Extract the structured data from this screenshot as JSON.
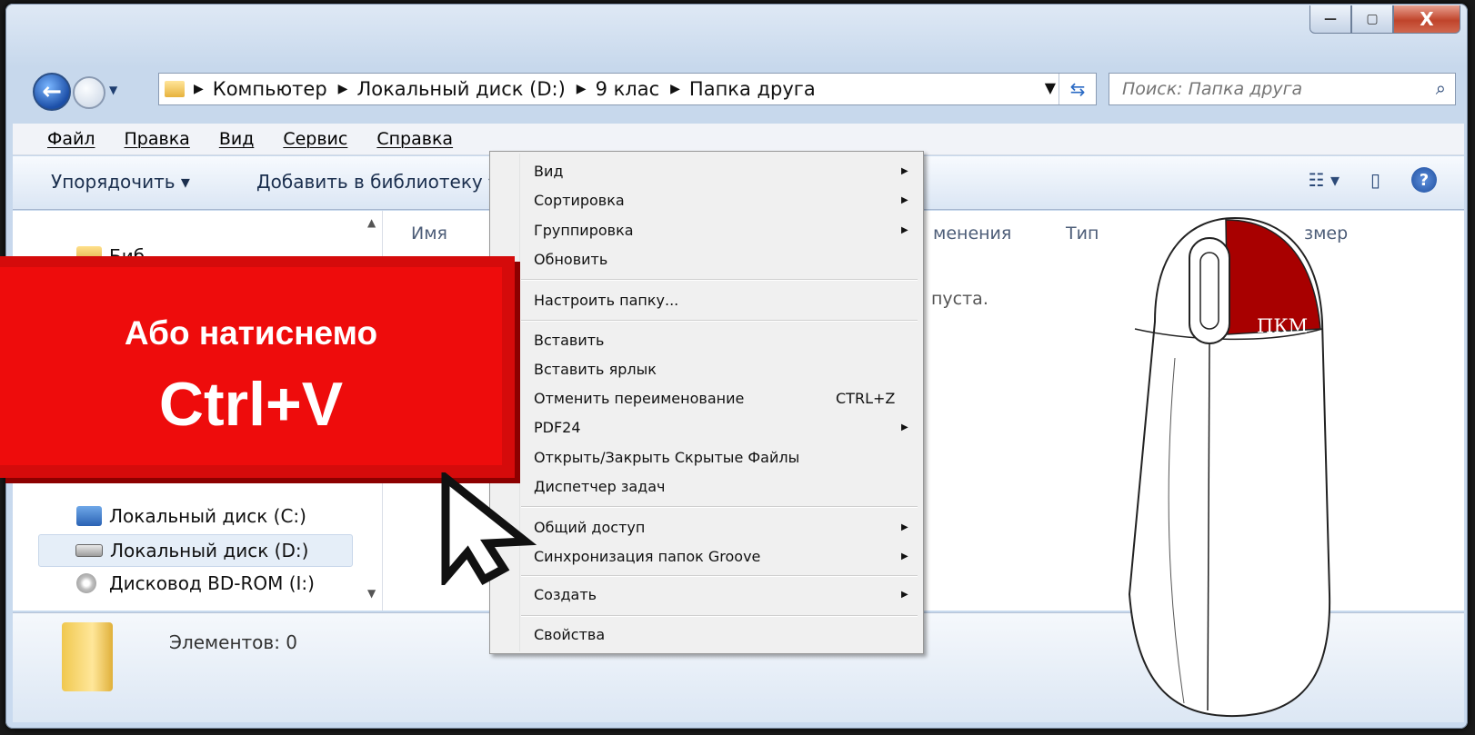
{
  "window": {
    "controls": {
      "minimize": "—",
      "maximize": "▢",
      "close": "X"
    }
  },
  "nav": {
    "back_icon": "←",
    "path": [
      "Компьютер",
      "Локальный диск (D:)",
      "9 клас",
      "Папка друга"
    ],
    "search_placeholder": "Поиск: Папка друга"
  },
  "menubar": {
    "items": [
      "Файл",
      "Правка",
      "Вид",
      "Сервис",
      "Справка"
    ]
  },
  "toolbar": {
    "organize": "Упорядочить ▾",
    "add_to_library": "Добавить в библиотеку ▾"
  },
  "navpane": {
    "partial_item": "Биб",
    "items": [
      "Локальный диск (C:)",
      "Локальный диск (D:)",
      "Дисковод BD-ROM (I:)"
    ]
  },
  "columns": {
    "name": "Имя",
    "date_partial": "менения",
    "type": "Тип",
    "size_partial": "змер"
  },
  "content": {
    "empty_partial": "пуста."
  },
  "status": {
    "items_count": "Элементов: 0"
  },
  "context_menu": {
    "items": [
      {
        "label": "Вид",
        "submenu": true
      },
      {
        "label": "Сортировка",
        "submenu": true
      },
      {
        "label": "Группировка",
        "submenu": true
      },
      {
        "label": "Обновить",
        "submenu": false
      },
      {
        "label": "Настроить папку...",
        "submenu": false
      },
      {
        "label": "Вставить",
        "submenu": false
      },
      {
        "label": "Вставить ярлык",
        "submenu": false
      },
      {
        "label": "Отменить переименование",
        "submenu": false,
        "shortcut": "CTRL+Z"
      },
      {
        "label": "PDF24",
        "submenu": true
      },
      {
        "label": "Открыть/Закрыть Скрытые Файлы",
        "submenu": false
      },
      {
        "label": "Диспетчер задач",
        "submenu": false
      },
      {
        "label": "Общий доступ",
        "submenu": true
      },
      {
        "label": "Синхронизация папок Groove",
        "submenu": true
      },
      {
        "label": "Создать",
        "submenu": true
      },
      {
        "label": "Свойства",
        "submenu": false
      }
    ]
  },
  "overlay": {
    "line1": "Або натиснемо",
    "line2": "Ctrl+V",
    "mouse_label": "ПКМ"
  },
  "colors": {
    "banner_red": "#ee0c0c",
    "mouse_button": "#a80000"
  }
}
